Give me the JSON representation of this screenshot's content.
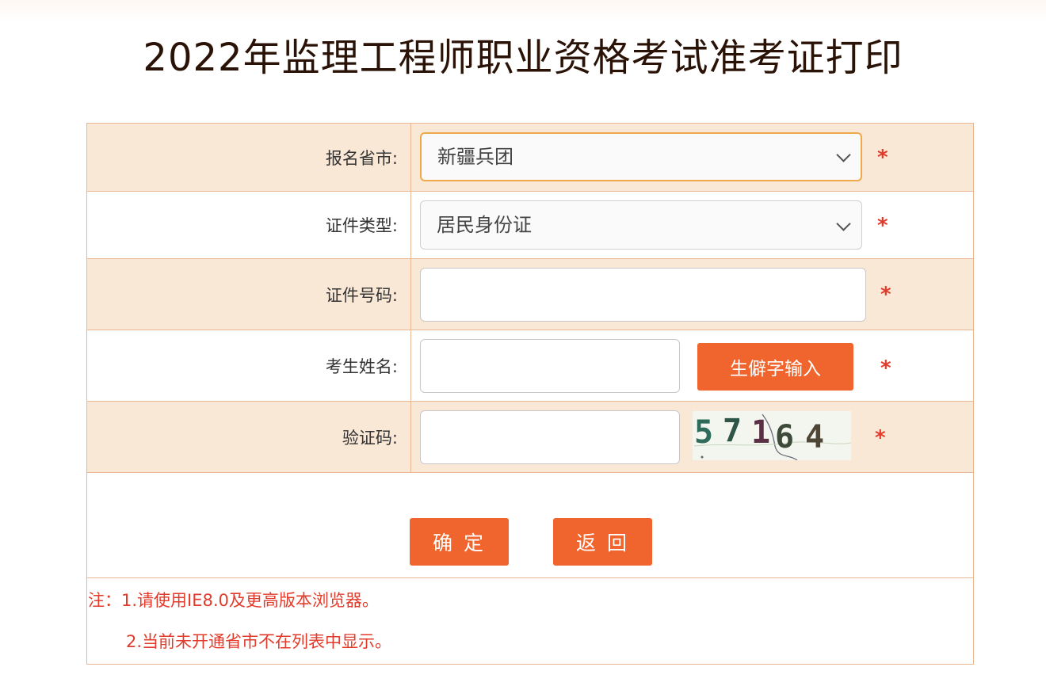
{
  "page": {
    "title": "2022年监理工程师职业资格考试准考证打印"
  },
  "form": {
    "province": {
      "label": "报名省市:",
      "value": "新疆兵团"
    },
    "id_type": {
      "label": "证件类型:",
      "value": "居民身份证"
    },
    "id_number": {
      "label": "证件号码:",
      "value": ""
    },
    "name": {
      "label": "考生姓名:",
      "value": "",
      "rare_char_button": "生僻字输入"
    },
    "captcha": {
      "label": "验证码:",
      "value": "",
      "image_text": "57164"
    },
    "required_mark": "*"
  },
  "actions": {
    "confirm": "确 定",
    "back": "返 回"
  },
  "notes": {
    "line1": "注：1.请使用IE8.0及更高版本浏览器。",
    "line2": "2.当前未开通省市不在列表中显示。"
  },
  "colors": {
    "accent_orange": "#f0652d",
    "row_tint": "#fae8d6",
    "border": "#e8b894",
    "required_red": "#e23b2b",
    "title": "#2a1207"
  },
  "icons": [
    "chevron-down-icon",
    "captcha-image"
  ]
}
